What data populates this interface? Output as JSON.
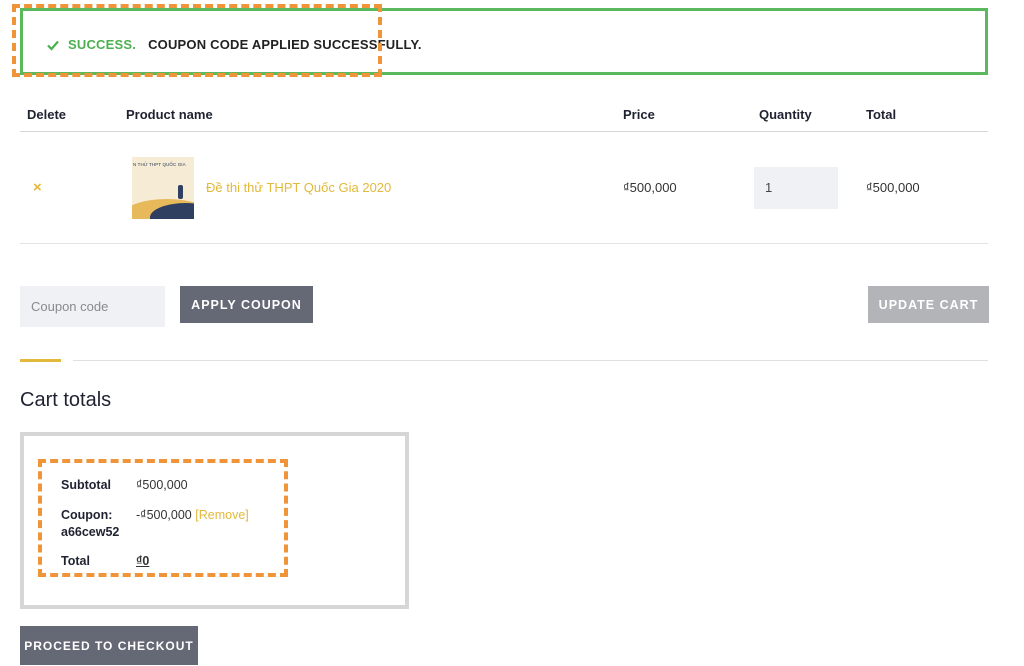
{
  "notice": {
    "success_label": "SUCCESS.",
    "message": "COUPON CODE APPLIED SUCCESSFULLY.",
    "icon": "check-icon"
  },
  "table": {
    "headers": {
      "delete": "Delete",
      "product": "Product name",
      "price": "Price",
      "quantity": "Quantity",
      "total": "Total"
    },
    "rows": [
      {
        "remove_icon": "×",
        "thumbnail_caption": "N THỬ THPT QUỐC GIA",
        "product_name": "Đề thi thử THPT Quốc Gia 2020",
        "price": "₫500,000",
        "quantity": "1",
        "total": "₫500,000"
      }
    ]
  },
  "coupon": {
    "placeholder": "Coupon code",
    "apply_label": "APPLY COUPON",
    "update_label": "UPDATE CART"
  },
  "totals": {
    "heading": "Cart totals",
    "subtotal_label": "Subtotal",
    "subtotal_value": "₫500,000",
    "coupon_label_line1": "Coupon:",
    "coupon_label_line2": "a66cew52",
    "coupon_value": "-₫500,000",
    "coupon_remove": "[Remove]",
    "total_label": "Total",
    "total_value": "₫0"
  },
  "checkout": {
    "label": "PROCEED TO CHECKOUT"
  },
  "colors": {
    "success": "#4caf50",
    "accent": "#e2b93a",
    "button": "#656875",
    "highlight": "#f0943a"
  }
}
